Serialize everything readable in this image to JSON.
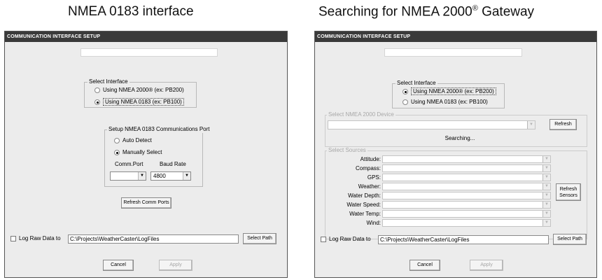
{
  "left": {
    "caption": "NMEA 0183 interface",
    "title": "COMMUNICATION INTERFACE SETUP",
    "select_interface": {
      "legend": "Select Interface",
      "option_2000": "Using NMEA 2000® (ex: PB200)",
      "option_0183": "Using NMEA 0183 (ex: PB100)",
      "selected": "0183"
    },
    "comm_port_group": {
      "legend": "Setup NMEA 0183 Communications Port",
      "auto_detect": "Auto Detect",
      "manually_select": "Manually Select",
      "selected": "manual",
      "comm_port_label": "Comm.Port",
      "baud_rate_label": "Baud Rate",
      "comm_port_value": "",
      "baud_rate_value": "4800"
    },
    "refresh_comm_ports": "Refresh Comm Ports",
    "log_raw_label": "Log Raw Data to",
    "log_path": "C:\\Projects\\WeatherCaster\\LogFiles",
    "select_path": "Select Path",
    "cancel": "Cancel",
    "apply": "Apply"
  },
  "right": {
    "caption_main": "Searching for NMEA 2000",
    "caption_sup": "®",
    "caption_tail": " Gateway",
    "title": "COMMUNICATION INTERFACE SETUP",
    "select_interface": {
      "legend": "Select Interface",
      "option_2000": "Using NMEA 2000® (ex: PB200)",
      "option_0183": "Using NMEA 0183 (ex: PB100)",
      "selected": "2000"
    },
    "device_group": {
      "legend": "Select NMEA 2000 Device",
      "refresh": "Refresh",
      "status": "Searching..."
    },
    "sources_group": {
      "legend": "Select Sources",
      "sources": [
        "Attitude:",
        "Compass:",
        "GPS:",
        "Weather:",
        "Water Depth:",
        "Water Speed:",
        "Water Temp:",
        "Wind:"
      ],
      "refresh_sensors": "Refresh Sensors"
    },
    "log_raw_label": "Log Raw Data to",
    "log_path": "C:\\Projects\\WeatherCaster\\LogFiles",
    "select_path": "Select Path",
    "cancel": "Cancel",
    "apply": "Apply"
  }
}
